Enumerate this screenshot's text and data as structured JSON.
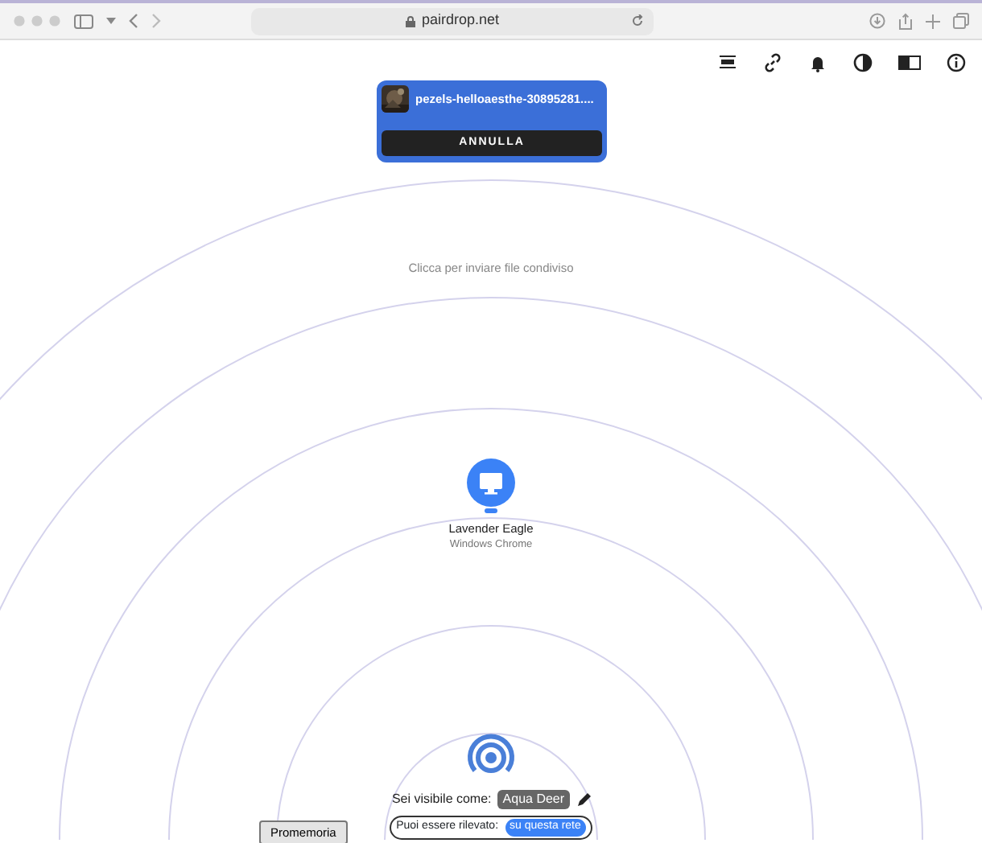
{
  "browser": {
    "url": "pairdrop.net"
  },
  "transfer": {
    "filename": "pezels-helloaesthe-30895281....",
    "button": "ANNULLA"
  },
  "hint": "Clicca per inviare file condiviso",
  "peers": [
    {
      "name": "Lavender Eagle",
      "device": "Windows Chrome"
    }
  ],
  "footer": {
    "label": "Sei visibile come:",
    "display_name": "Aqua Deer",
    "discovery_label": "Puoi essere rilevato:",
    "discovery_value": "su questa rete"
  },
  "reminder_button": "Promemoria"
}
